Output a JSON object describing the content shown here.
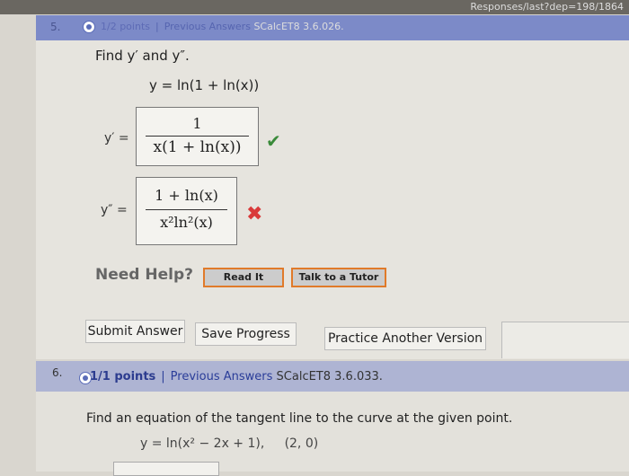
{
  "browser": {
    "url_fragment": "Responses/last?dep=198/1864"
  },
  "q5": {
    "number": "5.",
    "points": "1/2 points",
    "separator": "|",
    "status": "Previous Answers",
    "code": "SCalcET8 3.6.026.",
    "prompt": "Find y′ and y″.",
    "equation": "y = ln(1 + ln(x))",
    "yprime_label": "y′ =",
    "yprime_num": "1",
    "yprime_den": "x(1 + ln(x))",
    "ydouble_label": "y″ =",
    "ydouble_num": "1 + ln(x)",
    "ydouble_den": "x²ln²(x)",
    "correct_icon": "✔",
    "wrong_icon": "✖",
    "need_help": "Need Help?",
    "read_it": "Read It",
    "talk_tutor": "Talk to a Tutor",
    "submit": "Submit Answer",
    "save": "Save Progress",
    "practice": "Practice Another Version"
  },
  "q6": {
    "number": "6.",
    "points": "1/1 points",
    "separator": "|",
    "status": "Previous Answers",
    "code": "SCalcET8 3.6.033.",
    "prompt": "Find an equation of the tangent line to the curve at the given point.",
    "equation": "y = ln(x² − 2x + 1),     (2, 0)"
  }
}
